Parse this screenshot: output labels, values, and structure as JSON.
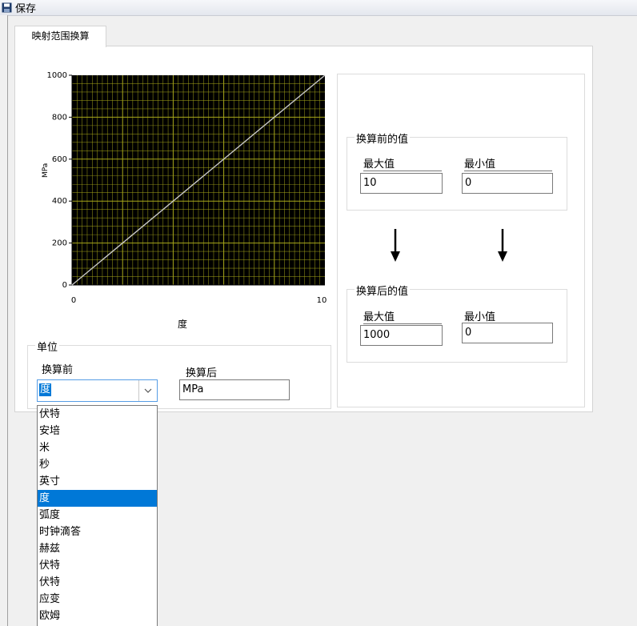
{
  "toolbar": {
    "save_label": "保存",
    "save_icon": "floppy-disk-icon"
  },
  "tabs": [
    {
      "label": "映射范围换算",
      "active": true
    }
  ],
  "chart_data": {
    "type": "line",
    "x": [
      0,
      10
    ],
    "series": [
      {
        "values": [
          0,
          1000
        ],
        "color": "#c8c8c8"
      }
    ],
    "xlim": [
      0,
      10
    ],
    "ylim": [
      0,
      1000
    ],
    "x_ticks": [
      "0",
      "10"
    ],
    "y_ticks": [
      "0",
      "200",
      "400",
      "600",
      "800",
      "1000"
    ],
    "xlabel": "度",
    "ylabel": "MPa",
    "grid": true,
    "background": "#000000",
    "grid_color": "#a8a81a"
  },
  "unit_group": {
    "title": "单位",
    "before_label": "换算前",
    "after_label": "换算后",
    "before_value": "度",
    "after_value": "MPa",
    "dropdown_icon": "chevron-down-icon",
    "options": [
      "伏特",
      "安培",
      "米",
      "秒",
      "英寸",
      "度",
      "弧度",
      "时钟滴答",
      "赫兹",
      "伏特",
      "伏特",
      "应变",
      "欧姆"
    ],
    "selected_index": 5
  },
  "before_group": {
    "title": "换算前的值",
    "max_label": "最大值",
    "min_label": "最小值",
    "max_value": "10",
    "min_value": "0"
  },
  "after_group": {
    "title": "换算后的值",
    "max_label": "最大值",
    "min_label": "最小值",
    "max_value": "1000",
    "min_value": "0"
  },
  "arrow_icon": "arrow-down-icon"
}
